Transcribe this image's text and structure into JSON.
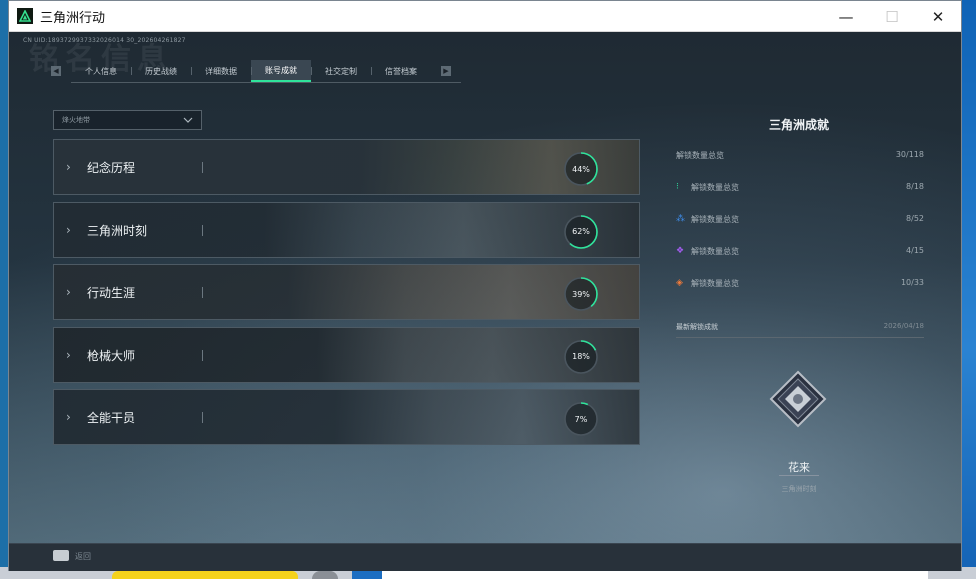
{
  "window": {
    "title": "三角洲行动",
    "controls": {
      "minimize": "—",
      "maximize": "☐",
      "close": "✕"
    }
  },
  "header": {
    "uid": "CN UID:1893729937332026014 30_202604261827",
    "watermark": "铭名信息"
  },
  "tabs": [
    {
      "label": "个人信息",
      "active": false
    },
    {
      "label": "历史战绩",
      "active": false
    },
    {
      "label": "详细数据",
      "active": false
    },
    {
      "label": "账号成就",
      "active": true
    },
    {
      "label": "社交定制",
      "active": false
    },
    {
      "label": "信誉档案",
      "active": false
    }
  ],
  "filter": {
    "value": "烽火地带"
  },
  "categories": [
    {
      "label": "纪念历程",
      "progress": 44,
      "progress_text": "44%"
    },
    {
      "label": "三角洲时刻",
      "progress": 62,
      "progress_text": "62%"
    },
    {
      "label": "行动生涯",
      "progress": 39,
      "progress_text": "39%"
    },
    {
      "label": "枪械大师",
      "progress": 18,
      "progress_text": "18%"
    },
    {
      "label": "全能干员",
      "progress": 7,
      "progress_text": "7%"
    }
  ],
  "panel": {
    "title": "三角洲成就",
    "total": {
      "label": "解锁数量总览",
      "value": "30/118"
    },
    "stats": [
      {
        "label": "解锁数量总览",
        "value": "8/18",
        "icon": "green-rank-icon",
        "color": "#2fd49a"
      },
      {
        "label": "解锁数量总览",
        "value": "8/52",
        "icon": "blue-rank-icon",
        "color": "#3f8ff0"
      },
      {
        "label": "解锁数量总览",
        "value": "4/15",
        "icon": "purple-rank-icon",
        "color": "#a35cf0"
      },
      {
        "label": "解锁数量总览",
        "value": "10/33",
        "icon": "orange-rank-icon",
        "color": "#f07a3a"
      }
    ],
    "latest": {
      "label": "最新解锁成就",
      "date": "2026/04/18"
    },
    "achievement": {
      "name": "花来",
      "category": "三角洲时刻"
    }
  },
  "footer": {
    "hint": "返回"
  },
  "colors": {
    "accent": "#2fe39b",
    "ring": "#2fe39b"
  }
}
